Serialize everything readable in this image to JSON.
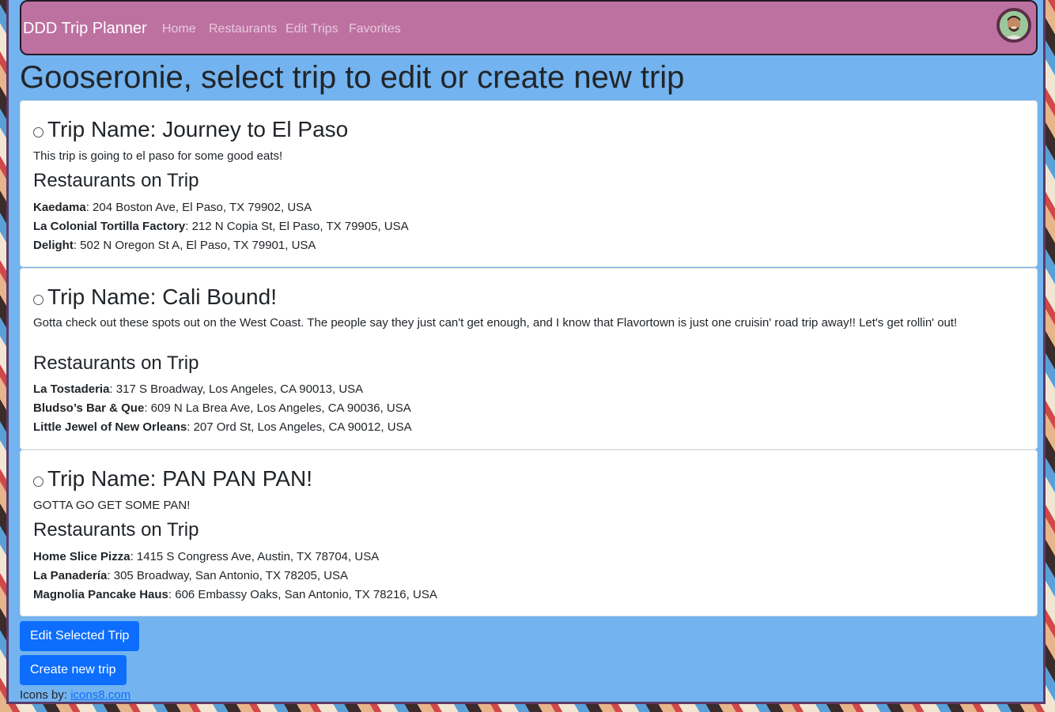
{
  "navbar": {
    "brand": "DDD Trip Planner",
    "links": [
      "Home",
      "Restaurants",
      "Edit Trips",
      "Favorites"
    ],
    "avatar": "user-avatar"
  },
  "page": {
    "title": "Gooseronie, select trip to edit or create new trip"
  },
  "section_label": "Restaurants on Trip",
  "trips": [
    {
      "name": "Trip Name: Journey to El Paso",
      "description": "This trip is going to el paso for some good eats!",
      "restaurants": [
        {
          "name": "Kaedama",
          "address": ": 204 Boston Ave, El Paso, TX 79902, USA"
        },
        {
          "name": "La Colonial Tortilla Factory",
          "address": ": 212 N Copia St, El Paso, TX 79905, USA"
        },
        {
          "name": "Delight",
          "address": ": 502 N Oregon St A, El Paso, TX 79901, USA"
        }
      ]
    },
    {
      "name": "Trip Name: Cali Bound!",
      "description": "Gotta check out these spots out on the West Coast. The people say they just can't get enough, and I know that Flavortown is just one cruisin' road trip away!! Let's get rollin' out!",
      "restaurants": [
        {
          "name": "La Tostaderia",
          "address": ": 317 S Broadway, Los Angeles, CA 90013, USA"
        },
        {
          "name": "Bludso’s Bar & Que",
          "address": ": 609 N La Brea Ave, Los Angeles, CA 90036, USA"
        },
        {
          "name": "Little Jewel of New Orleans",
          "address": ": 207 Ord St, Los Angeles, CA 90012, USA"
        }
      ]
    },
    {
      "name": "Trip Name: PAN PAN PAN!",
      "description": "GOTTA GO GET SOME PAN!",
      "restaurants": [
        {
          "name": "Home Slice Pizza",
          "address": ": 1415 S Congress Ave, Austin, TX 78704, USA"
        },
        {
          "name": "La Panadería",
          "address": ": 305 Broadway, San Antonio, TX 78205, USA"
        },
        {
          "name": "Magnolia Pancake Haus",
          "address": ": 606 Embassy Oaks, San Antonio, TX 78216, USA"
        }
      ]
    }
  ],
  "buttons": {
    "edit": "Edit Selected Trip",
    "create": "Create new trip"
  },
  "footer": {
    "prefix": "Icons by: ",
    "link": "icons8.com"
  },
  "colors": {
    "page_bg": "#73b3ef",
    "navbar_bg": "#bd71a1",
    "primary": "#0d6efd"
  }
}
